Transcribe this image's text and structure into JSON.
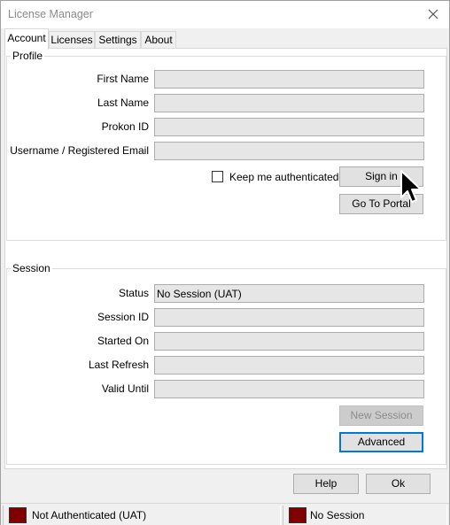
{
  "window": {
    "title": "License Manager"
  },
  "tabs": [
    {
      "label": "Account",
      "active": true
    },
    {
      "label": "Licenses",
      "active": false
    },
    {
      "label": "Settings",
      "active": false
    },
    {
      "label": "About",
      "active": false
    }
  ],
  "profile": {
    "group_label": "Profile",
    "first_name_label": "First Name",
    "first_name_value": "",
    "last_name_label": "Last Name",
    "last_name_value": "",
    "prokon_id_label": "Prokon ID",
    "prokon_id_value": "",
    "username_label": "Username / Registered Email",
    "username_value": "",
    "keep_authenticated_label": "Keep me authenticated",
    "keep_authenticated_checked": false,
    "sign_in_label": "Sign in",
    "portal_label": "Go To Portal"
  },
  "session": {
    "group_label": "Session",
    "status_label": "Status",
    "status_value": "No Session (UAT)",
    "session_id_label": "Session ID",
    "session_id_value": "",
    "started_on_label": "Started On",
    "started_on_value": "",
    "last_refresh_label": "Last Refresh",
    "last_refresh_value": "",
    "valid_until_label": "Valid Until",
    "valid_until_value": "",
    "new_session_label": "New Session",
    "new_session_enabled": false,
    "advanced_label": "Advanced"
  },
  "footer": {
    "help_label": "Help",
    "ok_label": "Ok"
  },
  "statusbar": {
    "auth_text": "Not Authenticated (UAT)",
    "session_text": "No Session",
    "indicator_color": "#800000"
  },
  "icons": {
    "close": "close-icon",
    "cursor": "mouse-pointer-icon"
  }
}
